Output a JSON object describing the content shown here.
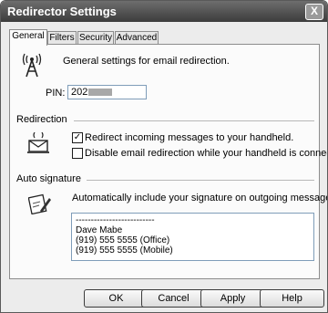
{
  "window": {
    "title": "Redirector Settings",
    "close_glyph": "X"
  },
  "tabs": [
    {
      "label": "General",
      "active": true
    },
    {
      "label": "Filters",
      "active": false
    },
    {
      "label": "Security",
      "active": false
    },
    {
      "label": "Advanced",
      "active": false
    }
  ],
  "general": {
    "description": "General settings for email redirection.",
    "pin_label": "PIN:",
    "pin_value": "202",
    "icon": "wireless-tower-icon"
  },
  "redirection": {
    "section_label": "Redirection",
    "icon": "envelope-wireless-icon",
    "redirect_incoming": {
      "label": "Redirect incoming messages to your handheld.",
      "checked": true,
      "check_glyph": "✓"
    },
    "disable_when_connected": {
      "label": "Disable email redirection while your handheld is connected.",
      "checked": false
    }
  },
  "auto_signature": {
    "section_label": "Auto signature",
    "icon": "signature-pen-icon",
    "description": "Automatically include your signature on outgoing messages.",
    "lines": [
      "--------------------------",
      "Dave Mabe",
      "(919) 555 5555 (Office)",
      "(919) 555 5555 (Mobile)"
    ]
  },
  "buttons": {
    "ok": "OK",
    "cancel": "Cancel",
    "apply": "Apply",
    "help": "Help"
  }
}
